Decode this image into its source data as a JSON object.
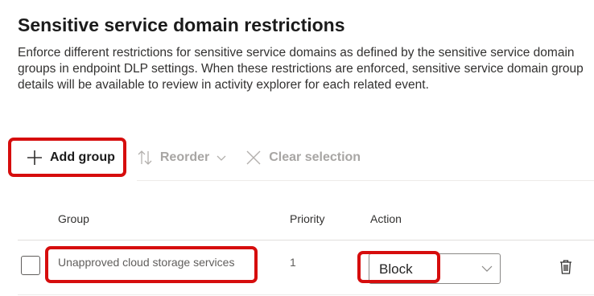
{
  "section": {
    "title": "Sensitive service domain restrictions",
    "description": "Enforce different restrictions for sensitive service domains as defined by the sensitive service domain groups in endpoint DLP settings. When these restrictions are enforced, sensitive service domain group details will be available to review in activity explorer for each related event."
  },
  "toolbar": {
    "add_group": "Add group",
    "reorder": "Reorder",
    "clear_selection": "Clear selection"
  },
  "table": {
    "headers": {
      "group": "Group",
      "priority": "Priority",
      "action": "Action"
    },
    "rows": [
      {
        "group": "Unapproved cloud storage services",
        "priority": "1",
        "action": "Block"
      }
    ]
  },
  "icons": {
    "add": "plus-icon",
    "reorder": "reorder-arrows-icon",
    "reorder_chevron": "chevron-down-icon",
    "clear": "close-icon",
    "select_chevron": "chevron-down-icon",
    "delete": "trash-icon"
  },
  "colors": {
    "highlight": "#d60d0d",
    "disabled_text": "#a8a6a4",
    "text": "#242424"
  }
}
